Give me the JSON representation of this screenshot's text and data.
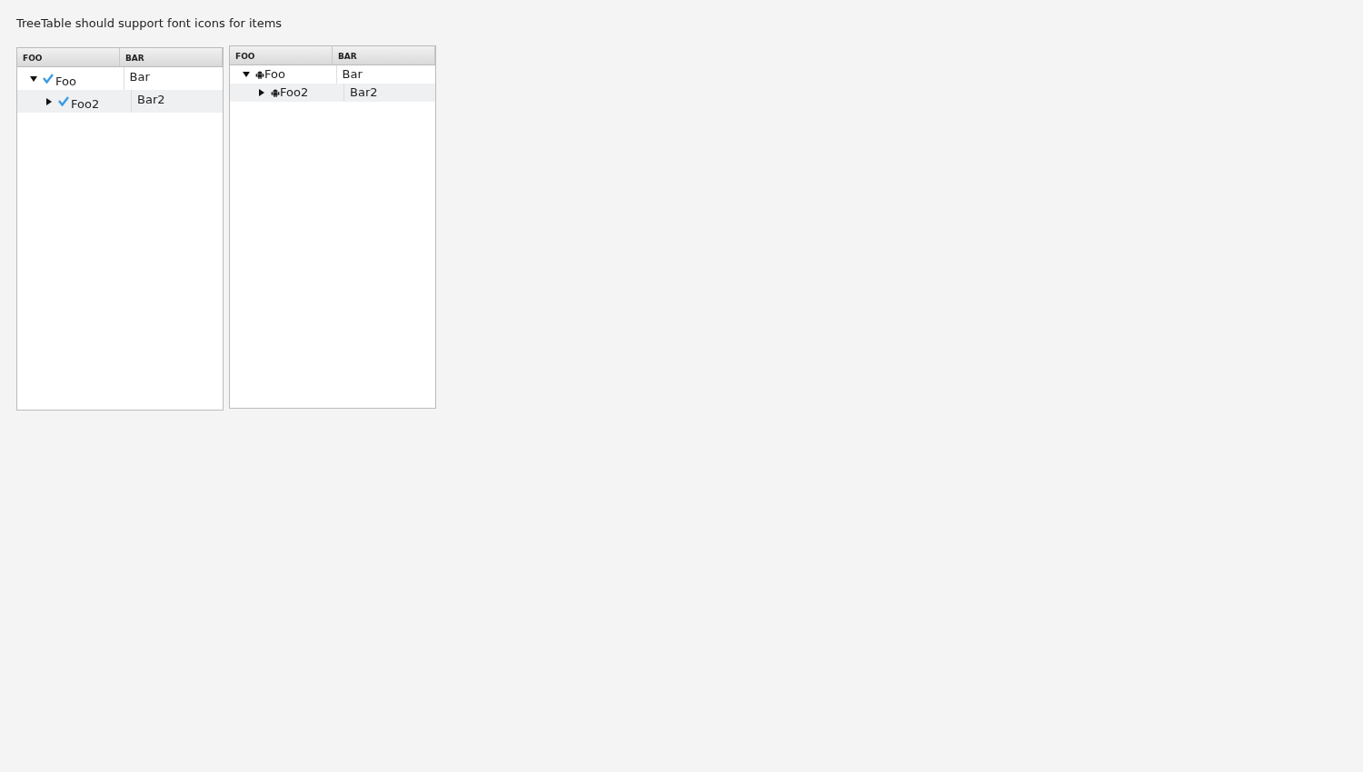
{
  "title": "TreeTable should support font icons for items",
  "tables": [
    {
      "kind": "check",
      "columns": [
        "FOO",
        "BAR"
      ],
      "rows": [
        {
          "foo": "Foo",
          "bar": "Bar",
          "expanded": true,
          "children": [
            {
              "foo": "Foo2",
              "bar": "Bar2",
              "expanded": false
            }
          ]
        }
      ]
    },
    {
      "kind": "android",
      "columns": [
        "FOO",
        "BAR"
      ],
      "rows": [
        {
          "foo": "Foo",
          "bar": "Bar",
          "expanded": true,
          "children": [
            {
              "foo": "Foo2",
              "bar": "Bar2",
              "expanded": false
            }
          ]
        }
      ]
    }
  ]
}
